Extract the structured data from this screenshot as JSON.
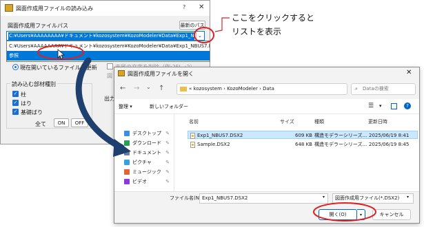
{
  "back_dialog": {
    "title": "図面作成用ファイルの読み込み",
    "help": "?",
    "close": "✕",
    "path_label": "図面作成用ファイルパス",
    "recent_button": "最新のパス",
    "combo_value": "C:¥Users¥AAAAAAAA¥ドキュメント¥kozosystem¥KozoModeler¥Data¥Exp1_NBUS7.DSX2",
    "dropdown_items": [
      "C:¥Users¥AAAAAAAA¥ドキュメント¥kozosystem¥KozoModeler¥Data¥Exp1_NBUS7.DSX2",
      "参照"
    ],
    "radio_label": "現在開いているファイルを更新",
    "end_char_label": "末尾の文字を削除（例:2FL→2）",
    "faded_label": "図",
    "members_title": "読み込む部材種別",
    "members": [
      "柱",
      "はり",
      "基礎ばり"
    ],
    "all_label": "全て",
    "on_label": "ON",
    "off_label": "OFF",
    "output_label": "出力"
  },
  "callout": {
    "line1": "ここをクリックすると",
    "line2": "リストを表示"
  },
  "open_dialog": {
    "title": "図面作成用ファイルを開く",
    "close": "✕",
    "address_parts": [
      "«",
      "kozosystem",
      "›",
      "KozoModeler",
      "›",
      "Data"
    ],
    "search_placeholder": "Dataの検索",
    "organize": "整理 ▾",
    "new_folder": "新しいフォルダー",
    "nav_items": [
      {
        "label": "デスクトップ",
        "color": "#3a8ee6"
      },
      {
        "label": "ダウンロード",
        "color": "#2a9d5a"
      },
      {
        "label": "ドキュメント",
        "color": "#6b7f99"
      },
      {
        "label": "ピクチャ",
        "color": "#3aa0d8"
      },
      {
        "label": "ミュージック",
        "color": "#e0643a"
      },
      {
        "label": "ビデオ",
        "color": "#8a3ad8"
      }
    ],
    "columns": [
      "名前",
      "サイズ",
      "種類",
      "更新日時"
    ],
    "files": [
      {
        "name": "Exp1_NBUS7.DSX2",
        "size": "609 KB",
        "type": "構造モデラーシリーズ...",
        "date": "2025/06/19 8:41"
      },
      {
        "name": "Sample.DSX2",
        "size": "648 KB",
        "type": "構造モデラーシリーズ...",
        "date": "2025/06/19 8:45"
      }
    ],
    "filename_label": "ファイル名(N):",
    "filename_value": "Exp1_NBUS7.DSX2",
    "filetype_value": "図面作成用ファイル(*.DSX2)",
    "open_button": "開く(O)",
    "cancel_button": "キャンセル"
  },
  "colors": {
    "accent": "#0078d7",
    "highlight_ring": "#e02020",
    "arrow": "#1f3f6e"
  }
}
